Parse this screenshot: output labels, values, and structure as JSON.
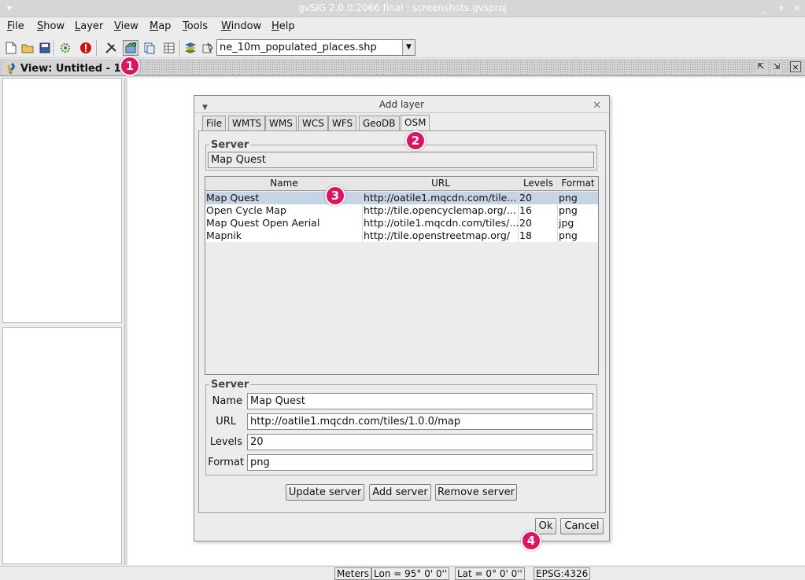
{
  "window": {
    "title": "gvSIG 2.0.0.2066 final : screenshots.gvsproj",
    "controls": [
      "_",
      "+",
      "×"
    ]
  },
  "menu": [
    {
      "label": "File",
      "mnemonic": "F",
      "rest": "ile"
    },
    {
      "label": "Show",
      "mnemonic": "S",
      "rest": "how"
    },
    {
      "label": "Layer",
      "mnemonic": "L",
      "rest": "ayer"
    },
    {
      "label": "View",
      "mnemonic": "V",
      "rest": "iew"
    },
    {
      "label": "Map",
      "mnemonic": "M",
      "rest": "ap"
    },
    {
      "label": "Tools",
      "mnemonic": "T",
      "rest": "ools"
    },
    {
      "label": "Window",
      "mnemonic": "W",
      "rest": "indow"
    },
    {
      "label": "Help",
      "mnemonic": "H",
      "rest": "elp"
    }
  ],
  "toolbar": {
    "active_layer": "ne_10m_populated_places.shp"
  },
  "view_frame": {
    "title": "View: Untitled - 1"
  },
  "dialog": {
    "title": "Add layer",
    "tabs": [
      "File",
      "WMTS",
      "WMS",
      "WCS",
      "WFS",
      "GeoDB",
      "OSM"
    ],
    "active_tab": "OSM",
    "server_group_label": "Server",
    "server_value": "Map Quest",
    "table": {
      "columns": [
        "Name",
        "URL",
        "Levels",
        "Format"
      ],
      "rows": [
        [
          "Map Quest",
          "http://oatile1.mqcdn.com/tile...",
          "20",
          "png"
        ],
        [
          "Open Cycle Map",
          "http://tile.opencyclemap.org/...",
          "16",
          "png"
        ],
        [
          "Map Quest Open Aerial",
          "http://otile1.mqcdn.com/tiles/...",
          "20",
          "jpg"
        ],
        [
          "Mapnik",
          "http://tile.openstreetmap.org/",
          "18",
          "png"
        ]
      ],
      "selected_row": 0
    },
    "detail": {
      "group_label": "Server",
      "name_label": "Name",
      "name_value": "Map Quest",
      "url_label": "URL",
      "url_value": "http://oatile1.mqcdn.com/tiles/1.0.0/map",
      "levels_label": "Levels",
      "levels_value": "20",
      "format_label": "Format",
      "format_value": "png"
    },
    "buttons": {
      "update": "Update server",
      "add": "Add server",
      "remove": "Remove server",
      "ok": "Ok",
      "cancel": "Cancel"
    }
  },
  "status": {
    "units": "Meters",
    "lon": "Lon = 95° 0' 0''",
    "lat": "Lat = 0° 0' 0''",
    "crs": "EPSG:4326"
  },
  "callouts": [
    "1",
    "2",
    "3",
    "4"
  ],
  "colors": {
    "callout": "#e0125f",
    "selection": "#c6d4e6"
  }
}
